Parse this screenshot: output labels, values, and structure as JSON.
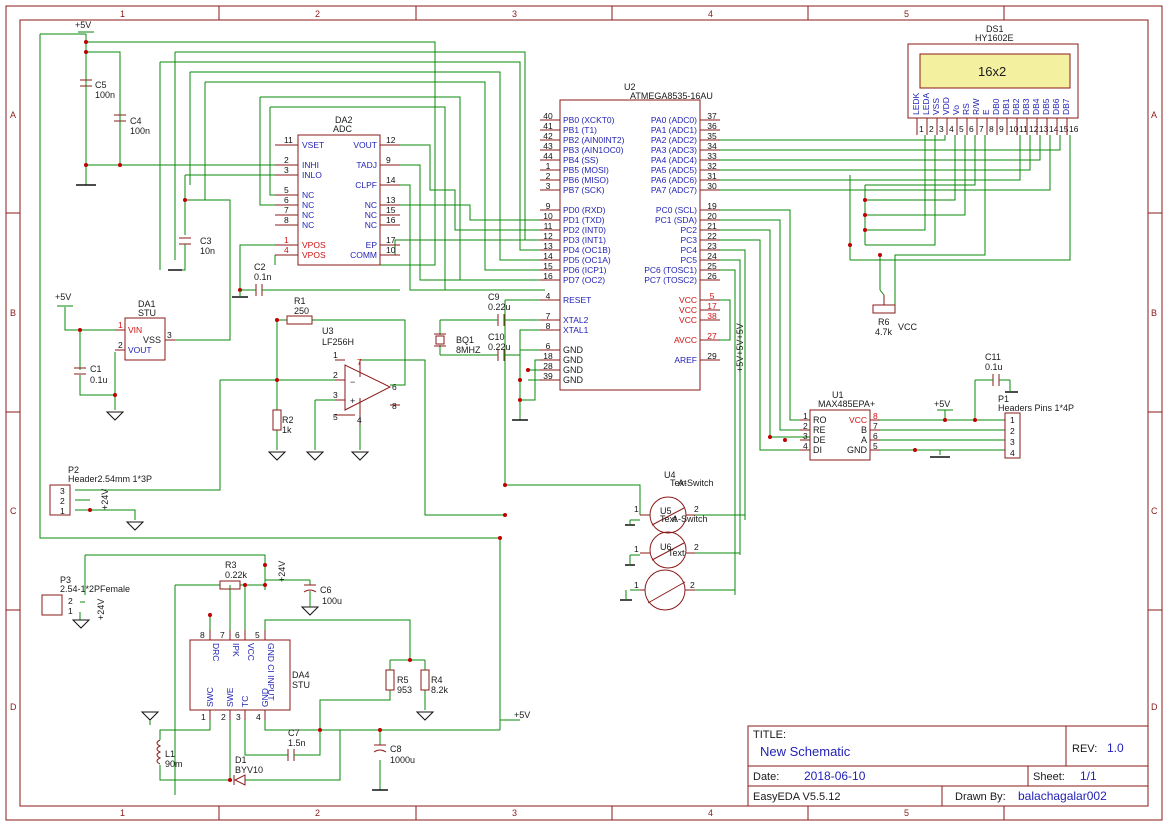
{
  "zones": {
    "cols": [
      "1",
      "2",
      "3",
      "4",
      "5"
    ],
    "rows": [
      "A",
      "B",
      "C",
      "D"
    ]
  },
  "title_block": {
    "title_label": "TITLE:",
    "title_value": "New Schematic",
    "rev_label": "REV:",
    "rev_value": "1.0",
    "date_label": "Date:",
    "date_value": "2018-06-10",
    "sheet_label": "Sheet:",
    "sheet_value": "1/1",
    "tool": "EasyEDA V5.5.12",
    "drawn_label": "Drawn By:",
    "drawn_value": "balachagalar002"
  },
  "power_labels": {
    "p5v_top": "+5V",
    "p5v_da1": "+5V",
    "p5v_u1": "+5V",
    "p5v_bottom": "+5V",
    "vcc_r6": "VCC",
    "p24v_p2": "+24V",
    "p24v_p3": "+24V",
    "p24v_da4": "+24V",
    "p5v_vertical": "+5V+5V+5V"
  },
  "parts": {
    "C5": {
      "ref": "C5",
      "val": "100n"
    },
    "C4": {
      "ref": "C4",
      "val": "100n"
    },
    "C3": {
      "ref": "C3",
      "val": "10n"
    },
    "C2": {
      "ref": "C2",
      "val": "0.1n"
    },
    "C1": {
      "ref": "C1",
      "val": "0.1u"
    },
    "C9": {
      "ref": "C9",
      "val": "0.22u"
    },
    "C10": {
      "ref": "C10",
      "val": "0.22u"
    },
    "C11": {
      "ref": "C11",
      "val": "0.1u"
    },
    "C6": {
      "ref": "C6",
      "val": "100u"
    },
    "C7": {
      "ref": "C7",
      "val": "1.5n"
    },
    "C8": {
      "ref": "C8",
      "val": "1000u"
    },
    "R1": {
      "ref": "R1",
      "val": "250"
    },
    "R2": {
      "ref": "R2",
      "val": "1k"
    },
    "R3": {
      "ref": "R3",
      "val": "0.22k"
    },
    "R4": {
      "ref": "R4",
      "val": "8.2k"
    },
    "R5": {
      "ref": "R5",
      "val": "953"
    },
    "R6": {
      "ref": "R6",
      "val": "4.7k"
    },
    "L1": {
      "ref": "L1",
      "val": "90m"
    },
    "D1": {
      "ref": "D1",
      "val": "BYV10"
    },
    "BQ1": {
      "ref": "BQ1",
      "val": "8MHZ"
    },
    "DA1": {
      "ref": "DA1",
      "val": "STU"
    },
    "DA2": {
      "ref": "DA2",
      "val": "ADC"
    },
    "DA4": {
      "ref": "DA4",
      "val": "STU"
    },
    "U2": {
      "ref": "U2",
      "val": "ATMEGA8535-16AU"
    },
    "U3": {
      "ref": "U3",
      "val": "LF256H"
    },
    "U1": {
      "ref": "U1",
      "val": "MAX485EPA+"
    },
    "DS1": {
      "ref": "DS1",
      "val": "HY1602E",
      "screen": "16x2"
    },
    "P1": {
      "ref": "P1",
      "val": "Headers  Pins 1*4P"
    },
    "P2": {
      "ref": "P2",
      "val": "Header2.54mm 1*3P"
    },
    "P3": {
      "ref": "P3",
      "val": "2.54-1*2PFemale"
    },
    "U4": {
      "ref": "U4",
      "val": "A-Switch",
      "text": "Text"
    },
    "U5": {
      "ref": "U5",
      "val": "A-Switch",
      "text": "Text"
    },
    "U6": {
      "ref": "U6",
      "text": "Text"
    }
  },
  "u2_left": [
    {
      "num": "40",
      "name": "PB0 (XCKT0)"
    },
    {
      "num": "41",
      "name": "PB1 (T1)"
    },
    {
      "num": "42",
      "name": "PB2 (AIN0INT2)"
    },
    {
      "num": "43",
      "name": "PB3 (AIN1OC0)"
    },
    {
      "num": "44",
      "name": "PB4 (SS)"
    },
    {
      "num": "1",
      "name": "PB5 (MOSI)"
    },
    {
      "num": "2",
      "name": "PB6 (MISO)"
    },
    {
      "num": "3",
      "name": "PB7 (SCK)"
    },
    {
      "num": "9",
      "name": "PD0 (RXD)"
    },
    {
      "num": "10",
      "name": "PD1 (TXD)"
    },
    {
      "num": "11",
      "name": "PD2 (INT0)"
    },
    {
      "num": "12",
      "name": "PD3 (INT1)"
    },
    {
      "num": "13",
      "name": "PD4 (OC1B)"
    },
    {
      "num": "14",
      "name": "PD5 (OC1A)"
    },
    {
      "num": "15",
      "name": "PD6 (ICP1)"
    },
    {
      "num": "16",
      "name": "PD7 (OC2)"
    },
    {
      "num": "4",
      "name": "RESET"
    },
    {
      "num": "7",
      "name": "XTAL2"
    },
    {
      "num": "8",
      "name": "XTAL1"
    },
    {
      "num": "6",
      "name": "GND"
    },
    {
      "num": "18",
      "name": "GND"
    },
    {
      "num": "28",
      "name": "GND"
    },
    {
      "num": "39",
      "name": "GND"
    }
  ],
  "u2_right": [
    {
      "num": "37",
      "name": "PA0 (ADC0)"
    },
    {
      "num": "36",
      "name": "PA1 (ADC1)"
    },
    {
      "num": "35",
      "name": "PA2 (ADC2)"
    },
    {
      "num": "34",
      "name": "PA3 (ADC3)"
    },
    {
      "num": "33",
      "name": "PA4 (ADC4)"
    },
    {
      "num": "32",
      "name": "PA5 (ADC5)"
    },
    {
      "num": "31",
      "name": "PA6 (ADC6)"
    },
    {
      "num": "30",
      "name": "PA7 (ADC7)"
    },
    {
      "num": "19",
      "name": "PC0 (SCL)"
    },
    {
      "num": "20",
      "name": "PC1 (SDA)"
    },
    {
      "num": "21",
      "name": "PC2"
    },
    {
      "num": "22",
      "name": "PC3"
    },
    {
      "num": "23",
      "name": "PC4"
    },
    {
      "num": "24",
      "name": "PC5"
    },
    {
      "num": "25",
      "name": "PC6 (TOSC1)"
    },
    {
      "num": "26",
      "name": "PC7 (TOSC2)"
    },
    {
      "num": "5",
      "name": "VCC"
    },
    {
      "num": "17",
      "name": "VCC"
    },
    {
      "num": "38",
      "name": "VCC"
    },
    {
      "num": "27",
      "name": "AVCC"
    },
    {
      "num": "29",
      "name": "AREF"
    }
  ],
  "da2_left": [
    {
      "num": "11",
      "name": "VSET"
    },
    {
      "num": "2",
      "name": "INHI"
    },
    {
      "num": "3",
      "name": "INLO"
    },
    {
      "num": "5",
      "name": "NC"
    },
    {
      "num": "6",
      "name": "NC"
    },
    {
      "num": "7",
      "name": "NC"
    },
    {
      "num": "8",
      "name": "NC"
    },
    {
      "num": "1",
      "name": "VPOS"
    },
    {
      "num": "4",
      "name": "VPOS"
    }
  ],
  "da2_right": [
    {
      "num": "12",
      "name": "VOUT"
    },
    {
      "num": "9",
      "name": "TADJ"
    },
    {
      "num": "14",
      "name": "CLPF"
    },
    {
      "num": "13",
      "name": "NC"
    },
    {
      "num": "15",
      "name": "NC"
    },
    {
      "num": "16",
      "name": "NC"
    },
    {
      "num": "17",
      "name": "EP"
    },
    {
      "num": "10",
      "name": "COMM"
    }
  ],
  "da1_pins": [
    {
      "num": "1",
      "name": "VIN"
    },
    {
      "num": "2",
      "name": "VOUT"
    },
    {
      "num": "3",
      "name": "VSS"
    }
  ],
  "u1_left": [
    {
      "num": "1",
      "name": "RO"
    },
    {
      "num": "2",
      "name": "RE"
    },
    {
      "num": "3",
      "name": "DE"
    },
    {
      "num": "4",
      "name": "DI"
    }
  ],
  "u1_right": [
    {
      "num": "8",
      "name": "VCC"
    },
    {
      "num": "7",
      "name": "B"
    },
    {
      "num": "6",
      "name": "A"
    },
    {
      "num": "5",
      "name": "GND"
    }
  ],
  "p1_pins": [
    "1",
    "2",
    "3",
    "4"
  ],
  "p2_pins": [
    "3",
    "2",
    "1"
  ],
  "p3_pins": [
    "2",
    "1"
  ],
  "da4_top": [
    {
      "num": "8",
      "name": "DRC"
    },
    {
      "num": "7",
      "name": "IPK"
    },
    {
      "num": "6",
      "name": "VCC"
    },
    {
      "num": "5",
      "name": "GND CI INPUT"
    }
  ],
  "da4_bottom": [
    {
      "num": "1",
      "name": "SWC"
    },
    {
      "num": "2",
      "name": "SWE"
    },
    {
      "num": "3",
      "name": "TC"
    },
    {
      "num": "4",
      "name": "GND"
    }
  ],
  "u3_pins": {
    "p1": "1",
    "p2": "2",
    "p3": "3",
    "p4": "4",
    "p5": "5",
    "p6": "6",
    "p7": "7",
    "p8": "8"
  },
  "lcd_pins": [
    {
      "num": "1",
      "name": "LEDK"
    },
    {
      "num": "2",
      "name": "LEDA"
    },
    {
      "num": "3",
      "name": "VSS"
    },
    {
      "num": "4",
      "name": "VDD"
    },
    {
      "num": "5",
      "name": "Vo"
    },
    {
      "num": "6",
      "name": "RS"
    },
    {
      "num": "7",
      "name": "R/W"
    },
    {
      "num": "8",
      "name": "E"
    },
    {
      "num": "9",
      "name": "DB0"
    },
    {
      "num": "10",
      "name": "DB1"
    },
    {
      "num": "11",
      "name": "DB2"
    },
    {
      "num": "12",
      "name": "DB3"
    },
    {
      "num": "13",
      "name": "DB4"
    },
    {
      "num": "14",
      "name": "DB5"
    },
    {
      "num": "15",
      "name": "DB6"
    },
    {
      "num": "16",
      "name": "DB7"
    }
  ],
  "switch_pins": {
    "a": "1",
    "b": "2"
  }
}
